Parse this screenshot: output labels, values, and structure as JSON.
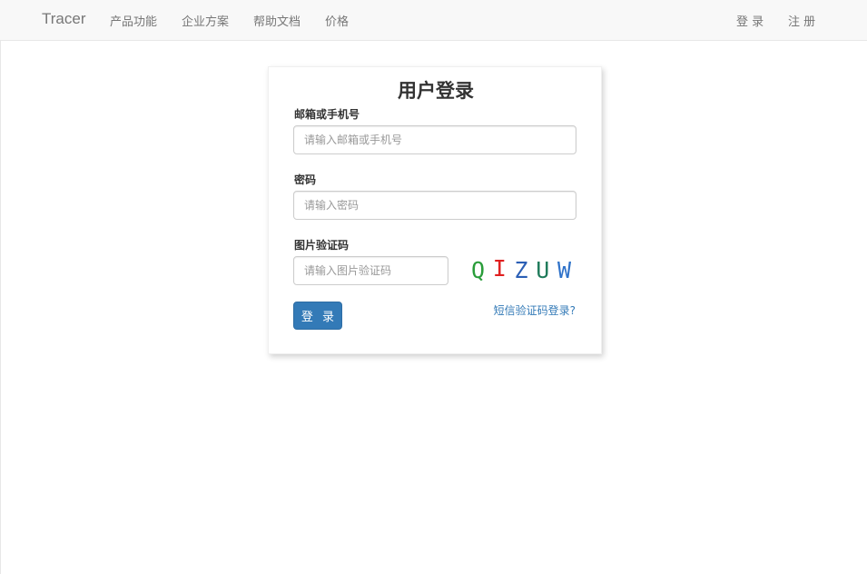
{
  "navbar": {
    "brand": "Tracer",
    "links": [
      "产品功能",
      "企业方案",
      "帮助文档",
      "价格"
    ],
    "login": "登 录",
    "register": "注 册"
  },
  "form": {
    "title": "用户登录",
    "account": {
      "label": "邮箱或手机号",
      "placeholder": "请输入邮箱或手机号",
      "value": ""
    },
    "password": {
      "label": "密码",
      "placeholder": "请输入密码",
      "value": ""
    },
    "captcha": {
      "label": "图片验证码",
      "placeholder": "请输入图片验证码",
      "value": "",
      "chars": [
        "Q",
        "I",
        "Z",
        "U",
        "W"
      ],
      "colors": [
        "#2a9d3a",
        "#e02020",
        "#2b5fb5",
        "#1e7a5a",
        "#2f72c9"
      ]
    },
    "submit_label": "登 录",
    "sms_link": "短信验证码登录?"
  }
}
